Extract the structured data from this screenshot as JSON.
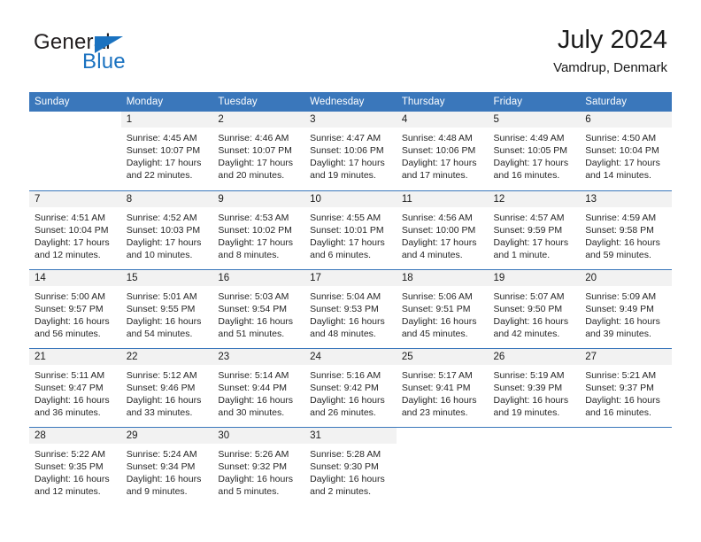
{
  "brand": {
    "name_top": "General",
    "name_bottom": "Blue",
    "accent_color": "#1a72c0",
    "text_color": "#231f20"
  },
  "header": {
    "title": "July 2024",
    "subtitle": "Vamdrup, Denmark"
  },
  "theme": {
    "header_row_bg": "#3a77bb",
    "header_row_text": "#ffffff",
    "daynum_band_bg": "#f2f2f2",
    "row_separator": "#3a77bb",
    "body_text": "#262626"
  },
  "calendar": {
    "weekday_headers": [
      "Sunday",
      "Monday",
      "Tuesday",
      "Wednesday",
      "Thursday",
      "Friday",
      "Saturday"
    ],
    "labels": {
      "sunrise": "Sunrise:",
      "sunset": "Sunset:",
      "daylight": "Daylight:"
    },
    "weeks": [
      [
        {
          "day": "",
          "lines": []
        },
        {
          "day": "1",
          "lines": [
            "Sunrise: 4:45 AM",
            "Sunset: 10:07 PM",
            "Daylight: 17 hours",
            "and 22 minutes."
          ]
        },
        {
          "day": "2",
          "lines": [
            "Sunrise: 4:46 AM",
            "Sunset: 10:07 PM",
            "Daylight: 17 hours",
            "and 20 minutes."
          ]
        },
        {
          "day": "3",
          "lines": [
            "Sunrise: 4:47 AM",
            "Sunset: 10:06 PM",
            "Daylight: 17 hours",
            "and 19 minutes."
          ]
        },
        {
          "day": "4",
          "lines": [
            "Sunrise: 4:48 AM",
            "Sunset: 10:06 PM",
            "Daylight: 17 hours",
            "and 17 minutes."
          ]
        },
        {
          "day": "5",
          "lines": [
            "Sunrise: 4:49 AM",
            "Sunset: 10:05 PM",
            "Daylight: 17 hours",
            "and 16 minutes."
          ]
        },
        {
          "day": "6",
          "lines": [
            "Sunrise: 4:50 AM",
            "Sunset: 10:04 PM",
            "Daylight: 17 hours",
            "and 14 minutes."
          ]
        }
      ],
      [
        {
          "day": "7",
          "lines": [
            "Sunrise: 4:51 AM",
            "Sunset: 10:04 PM",
            "Daylight: 17 hours",
            "and 12 minutes."
          ]
        },
        {
          "day": "8",
          "lines": [
            "Sunrise: 4:52 AM",
            "Sunset: 10:03 PM",
            "Daylight: 17 hours",
            "and 10 minutes."
          ]
        },
        {
          "day": "9",
          "lines": [
            "Sunrise: 4:53 AM",
            "Sunset: 10:02 PM",
            "Daylight: 17 hours",
            "and 8 minutes."
          ]
        },
        {
          "day": "10",
          "lines": [
            "Sunrise: 4:55 AM",
            "Sunset: 10:01 PM",
            "Daylight: 17 hours",
            "and 6 minutes."
          ]
        },
        {
          "day": "11",
          "lines": [
            "Sunrise: 4:56 AM",
            "Sunset: 10:00 PM",
            "Daylight: 17 hours",
            "and 4 minutes."
          ]
        },
        {
          "day": "12",
          "lines": [
            "Sunrise: 4:57 AM",
            "Sunset: 9:59 PM",
            "Daylight: 17 hours",
            "and 1 minute."
          ]
        },
        {
          "day": "13",
          "lines": [
            "Sunrise: 4:59 AM",
            "Sunset: 9:58 PM",
            "Daylight: 16 hours",
            "and 59 minutes."
          ]
        }
      ],
      [
        {
          "day": "14",
          "lines": [
            "Sunrise: 5:00 AM",
            "Sunset: 9:57 PM",
            "Daylight: 16 hours",
            "and 56 minutes."
          ]
        },
        {
          "day": "15",
          "lines": [
            "Sunrise: 5:01 AM",
            "Sunset: 9:55 PM",
            "Daylight: 16 hours",
            "and 54 minutes."
          ]
        },
        {
          "day": "16",
          "lines": [
            "Sunrise: 5:03 AM",
            "Sunset: 9:54 PM",
            "Daylight: 16 hours",
            "and 51 minutes."
          ]
        },
        {
          "day": "17",
          "lines": [
            "Sunrise: 5:04 AM",
            "Sunset: 9:53 PM",
            "Daylight: 16 hours",
            "and 48 minutes."
          ]
        },
        {
          "day": "18",
          "lines": [
            "Sunrise: 5:06 AM",
            "Sunset: 9:51 PM",
            "Daylight: 16 hours",
            "and 45 minutes."
          ]
        },
        {
          "day": "19",
          "lines": [
            "Sunrise: 5:07 AM",
            "Sunset: 9:50 PM",
            "Daylight: 16 hours",
            "and 42 minutes."
          ]
        },
        {
          "day": "20",
          "lines": [
            "Sunrise: 5:09 AM",
            "Sunset: 9:49 PM",
            "Daylight: 16 hours",
            "and 39 minutes."
          ]
        }
      ],
      [
        {
          "day": "21",
          "lines": [
            "Sunrise: 5:11 AM",
            "Sunset: 9:47 PM",
            "Daylight: 16 hours",
            "and 36 minutes."
          ]
        },
        {
          "day": "22",
          "lines": [
            "Sunrise: 5:12 AM",
            "Sunset: 9:46 PM",
            "Daylight: 16 hours",
            "and 33 minutes."
          ]
        },
        {
          "day": "23",
          "lines": [
            "Sunrise: 5:14 AM",
            "Sunset: 9:44 PM",
            "Daylight: 16 hours",
            "and 30 minutes."
          ]
        },
        {
          "day": "24",
          "lines": [
            "Sunrise: 5:16 AM",
            "Sunset: 9:42 PM",
            "Daylight: 16 hours",
            "and 26 minutes."
          ]
        },
        {
          "day": "25",
          "lines": [
            "Sunrise: 5:17 AM",
            "Sunset: 9:41 PM",
            "Daylight: 16 hours",
            "and 23 minutes."
          ]
        },
        {
          "day": "26",
          "lines": [
            "Sunrise: 5:19 AM",
            "Sunset: 9:39 PM",
            "Daylight: 16 hours",
            "and 19 minutes."
          ]
        },
        {
          "day": "27",
          "lines": [
            "Sunrise: 5:21 AM",
            "Sunset: 9:37 PM",
            "Daylight: 16 hours",
            "and 16 minutes."
          ]
        }
      ],
      [
        {
          "day": "28",
          "lines": [
            "Sunrise: 5:22 AM",
            "Sunset: 9:35 PM",
            "Daylight: 16 hours",
            "and 12 minutes."
          ]
        },
        {
          "day": "29",
          "lines": [
            "Sunrise: 5:24 AM",
            "Sunset: 9:34 PM",
            "Daylight: 16 hours",
            "and 9 minutes."
          ]
        },
        {
          "day": "30",
          "lines": [
            "Sunrise: 5:26 AM",
            "Sunset: 9:32 PM",
            "Daylight: 16 hours",
            "and 5 minutes."
          ]
        },
        {
          "day": "31",
          "lines": [
            "Sunrise: 5:28 AM",
            "Sunset: 9:30 PM",
            "Daylight: 16 hours",
            "and 2 minutes."
          ]
        },
        {
          "day": "",
          "lines": []
        },
        {
          "day": "",
          "lines": []
        },
        {
          "day": "",
          "lines": []
        }
      ]
    ]
  }
}
